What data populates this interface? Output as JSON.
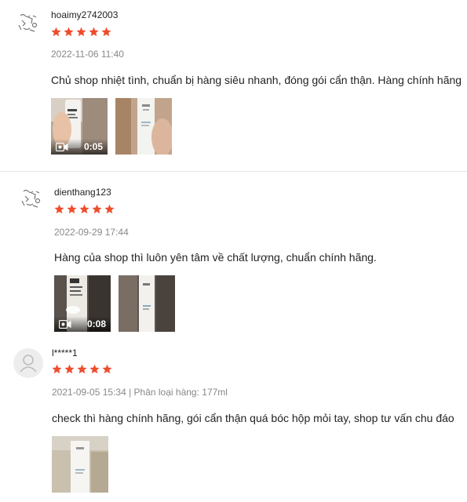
{
  "colors": {
    "star": "#ee4d2d",
    "meta": "#888888",
    "divider": "#e8e8e8"
  },
  "reviews": [
    {
      "username": "hoaimy2742003",
      "rating": 5,
      "meta": "2022-11-06 11:40",
      "comment": "Chủ shop nhiệt tình, chuẩn bị hàng siêu nhanh, đóng gói cẩn thận. Hàng chính hãng",
      "media": [
        {
          "type": "video",
          "duration": "0:05"
        },
        {
          "type": "image"
        }
      ]
    },
    {
      "username": "dienthang123",
      "rating": 5,
      "meta": "2022-09-29 17:44",
      "comment": "Hàng của shop thì luôn yên tâm về chất lượng, chuẩn chính hãng.",
      "media": [
        {
          "type": "video",
          "duration": "0:08"
        },
        {
          "type": "image"
        }
      ]
    },
    {
      "username": "l*****1",
      "rating": 5,
      "meta": "2021-09-05 15:34 | Phân loại hàng: 177ml",
      "comment": "check thì hàng chính hãng, gói cẩn thận quá bóc hộp mỏi tay, shop tư vấn chu đáo",
      "media": [
        {
          "type": "image"
        }
      ]
    }
  ]
}
